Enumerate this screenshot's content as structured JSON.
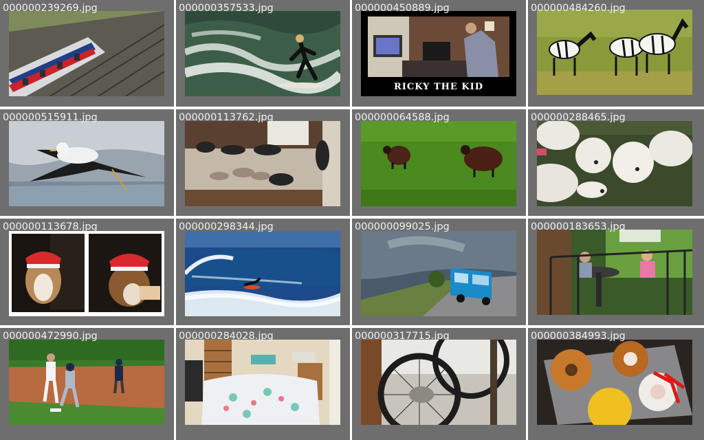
{
  "gallery": {
    "items": [
      {
        "filename": "000000239269.jpg",
        "subject": "train"
      },
      {
        "filename": "000000357533.jpg",
        "subject": "surfer"
      },
      {
        "filename": "000000450889.jpg",
        "subject": "ricky",
        "caption_text": "RICKY THE KID"
      },
      {
        "filename": "000000484260.jpg",
        "subject": "zebras"
      },
      {
        "filename": "000000515911.jpg",
        "subject": "gull"
      },
      {
        "filename": "000000113762.jpg",
        "subject": "cats"
      },
      {
        "filename": "000000064588.jpg",
        "subject": "sheep-field"
      },
      {
        "filename": "000000288465.jpg",
        "subject": "sheep-flock"
      },
      {
        "filename": "000000113678.jpg",
        "subject": "dogs"
      },
      {
        "filename": "000000298344.jpg",
        "subject": "wave"
      },
      {
        "filename": "000000099025.jpg",
        "subject": "bus"
      },
      {
        "filename": "000000183653.jpg",
        "subject": "porch"
      },
      {
        "filename": "000000472990.jpg",
        "subject": "baseball"
      },
      {
        "filename": "000000284028.jpg",
        "subject": "bedroom"
      },
      {
        "filename": "000000317715.jpg",
        "subject": "bike-cat"
      },
      {
        "filename": "000000384993.jpg",
        "subject": "donuts"
      }
    ]
  },
  "colors": {
    "tile_background": "#6e6e6e",
    "caption_text": "#f2f2f2",
    "page_background": "#ffffff"
  }
}
